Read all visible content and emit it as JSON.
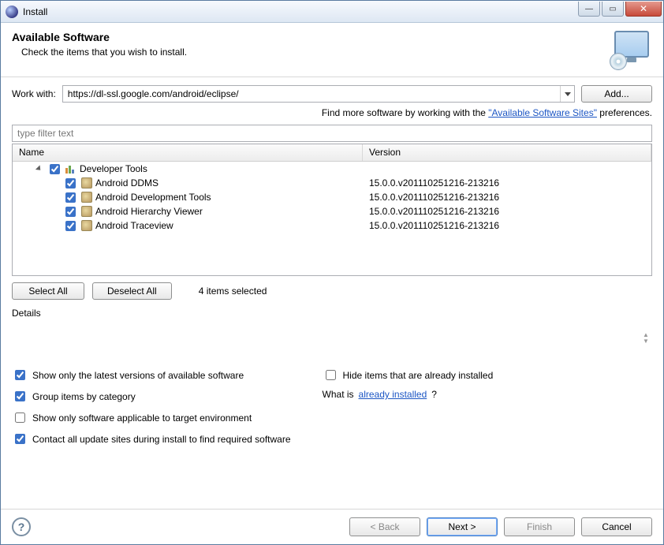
{
  "window": {
    "title": "Install"
  },
  "header": {
    "title": "Available Software",
    "subtitle": "Check the items that you wish to install."
  },
  "workwith": {
    "label": "Work with:",
    "value": "https://dl-ssl.google.com/android/eclipse/",
    "add_label": "Add..."
  },
  "hint": {
    "prefix": "Find more software by working with the ",
    "link": "\"Available Software Sites\"",
    "suffix": " preferences."
  },
  "filter_placeholder": "type filter text",
  "columns": {
    "name": "Name",
    "version": "Version"
  },
  "category": {
    "label": "Developer Tools"
  },
  "items": [
    {
      "label": "Android DDMS",
      "version": "15.0.0.v201110251216-213216"
    },
    {
      "label": "Android Development Tools",
      "version": "15.0.0.v201110251216-213216"
    },
    {
      "label": "Android Hierarchy Viewer",
      "version": "15.0.0.v201110251216-213216"
    },
    {
      "label": "Android Traceview",
      "version": "15.0.0.v201110251216-213216"
    }
  ],
  "selection": {
    "select_all": "Select All",
    "deselect_all": "Deselect All",
    "status": "4 items selected"
  },
  "details_label": "Details",
  "options_left": [
    {
      "label": "Show only the latest versions of available software",
      "checked": true
    },
    {
      "label": "Group items by category",
      "checked": true
    },
    {
      "label": "Show only software applicable to target environment",
      "checked": false
    },
    {
      "label": "Contact all update sites during install to find required software",
      "checked": true
    }
  ],
  "options_right": {
    "hide": {
      "label": "Hide items that are already installed",
      "checked": false
    },
    "whatis_prefix": "What is ",
    "whatis_link": "already installed",
    "whatis_suffix": "?"
  },
  "footer": {
    "back": "< Back",
    "next": "Next >",
    "finish": "Finish",
    "cancel": "Cancel"
  }
}
